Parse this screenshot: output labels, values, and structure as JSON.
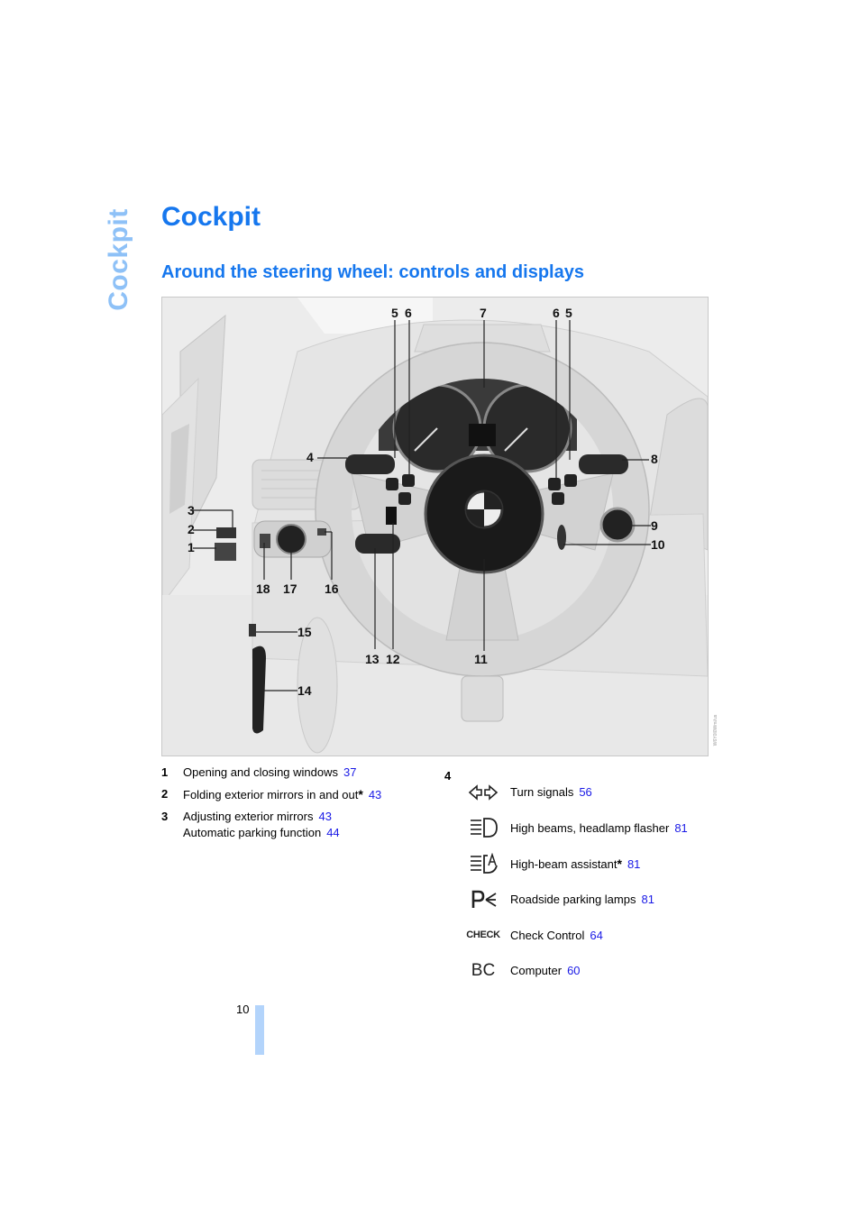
{
  "side_tab": {
    "label": "Cockpit"
  },
  "header": {
    "title": "Cockpit",
    "section_title": "Around the steering wheel: controls and displays"
  },
  "figure": {
    "callouts": [
      "1",
      "2",
      "3",
      "4",
      "5",
      "6",
      "7",
      "6",
      "5",
      "8",
      "9",
      "10",
      "11",
      "12",
      "13",
      "14",
      "15",
      "16",
      "17",
      "18"
    ],
    "watermark": "W6Y0I0Wmi/us"
  },
  "colors": {
    "heading": "#1677ee",
    "side_tab": "#8ec1f7",
    "page_ref": "#1a1ae6",
    "page_bar": "#b3d4fb"
  },
  "legend_left": [
    {
      "num": "1",
      "text": "Opening and closing windows",
      "star": false,
      "page": "37"
    },
    {
      "num": "2",
      "text": "Folding exterior mirrors in and out",
      "star": true,
      "page": "43"
    },
    {
      "num": "3",
      "text": "Adjusting exterior mirrors",
      "star": false,
      "page": "43",
      "sub_text": "Automatic parking function",
      "sub_page": "44"
    }
  ],
  "legend_right": {
    "num": "4",
    "items": [
      {
        "icon": "turn-signals-icon",
        "text": "Turn signals",
        "star": false,
        "page": "56"
      },
      {
        "icon": "high-beam-icon",
        "text": "High beams, headlamp flasher",
        "star": false,
        "page": "81"
      },
      {
        "icon": "high-beam-assistant-icon",
        "text": "High-beam assistant",
        "star": true,
        "page": "81"
      },
      {
        "icon": "parking-lamps-icon",
        "text": "Roadside parking lamps",
        "star": false,
        "page": "81"
      },
      {
        "icon": "check-control-icon",
        "icon_text": "CHECK",
        "text": "Check Control",
        "star": false,
        "page": "64"
      },
      {
        "icon": "computer-icon",
        "icon_text": "BC",
        "text": "Computer",
        "star": false,
        "page": "60"
      }
    ]
  },
  "footer": {
    "page_number": "10"
  },
  "star_symbol": "*"
}
